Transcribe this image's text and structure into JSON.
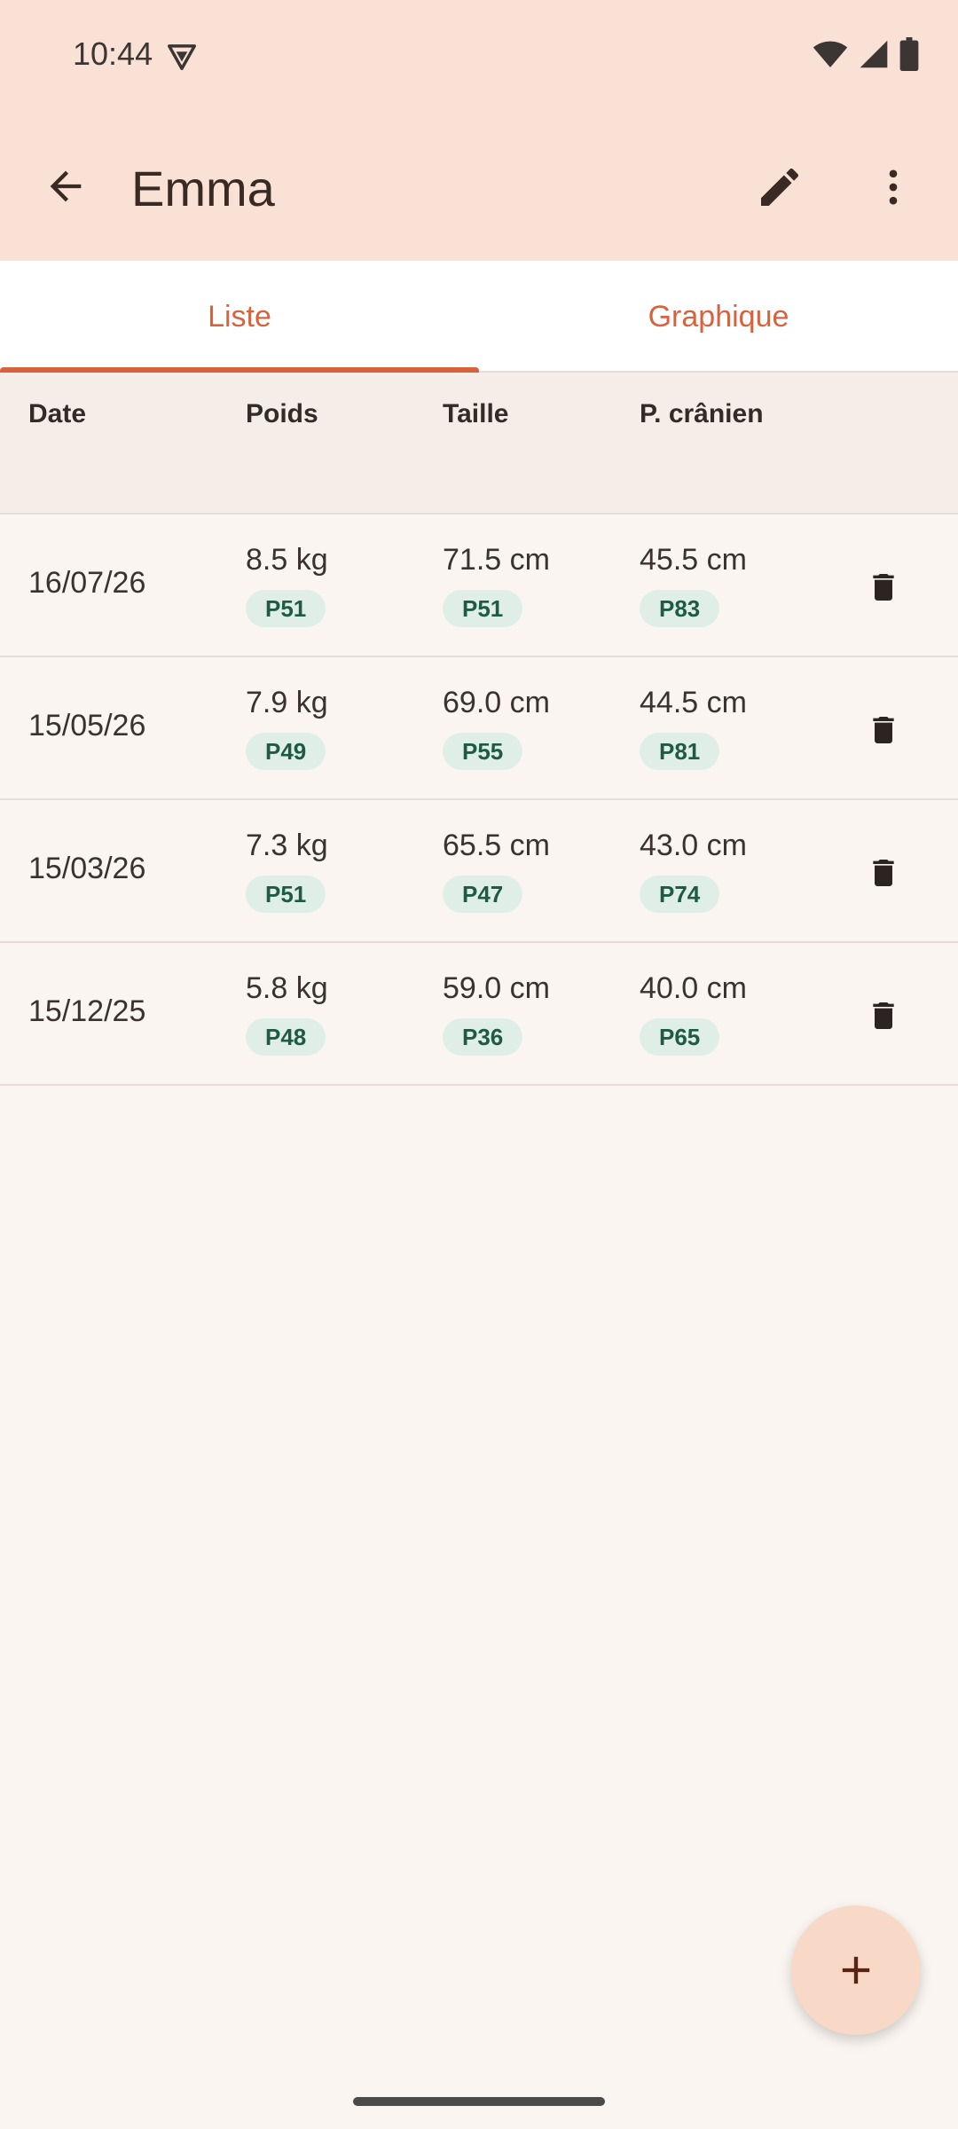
{
  "status_bar": {
    "time": "10:44",
    "icons": [
      "vpn-shield-icon",
      "wifi-icon",
      "signal-icon",
      "battery-icon"
    ]
  },
  "app_bar": {
    "title": "Emma",
    "icons": {
      "back": "arrow-left-icon",
      "edit": "pencil-icon",
      "more": "more-vert-icon"
    }
  },
  "tabs": [
    {
      "label": "Liste",
      "selected": true
    },
    {
      "label": "Graphique",
      "selected": false
    }
  ],
  "table": {
    "headers": [
      "Date",
      "Poids",
      "Taille",
      "P. crânien"
    ],
    "rows": [
      {
        "date": "16/07/26",
        "poids": "8.5 kg",
        "poids_p": "P51",
        "taille": "71.5 cm",
        "taille_p": "P51",
        "crane": "45.5 cm",
        "crane_p": "P83"
      },
      {
        "date": "15/05/26",
        "poids": "7.9 kg",
        "poids_p": "P49",
        "taille": "69.0 cm",
        "taille_p": "P55",
        "crane": "44.5 cm",
        "crane_p": "P81"
      },
      {
        "date": "15/03/26",
        "poids": "7.3 kg",
        "poids_p": "P51",
        "taille": "65.5 cm",
        "taille_p": "P47",
        "crane": "43.0 cm",
        "crane_p": "P74"
      },
      {
        "date": "15/12/25",
        "poids": "5.8 kg",
        "poids_p": "P48",
        "taille": "59.0 cm",
        "taille_p": "P36",
        "crane": "40.0 cm",
        "crane_p": "P65"
      }
    ]
  },
  "fab": {
    "icon": "plus-icon"
  },
  "colors": {
    "accent": "#D9623E",
    "peach": "#FAE1D6",
    "badge_bg": "#DFEFE8",
    "badge_text": "#1F5A45"
  }
}
